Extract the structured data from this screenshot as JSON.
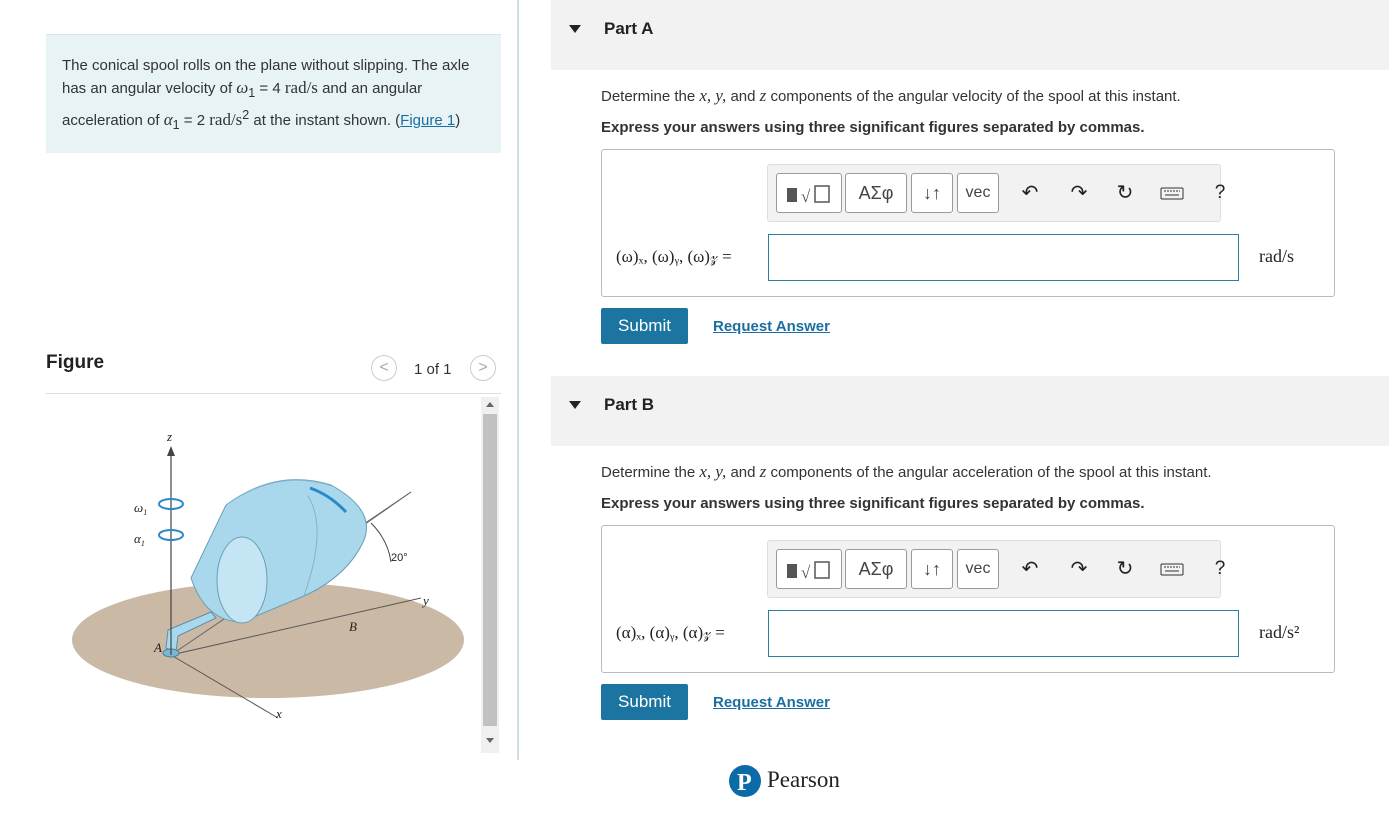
{
  "problem": {
    "text_1": "The conical spool rolls on the plane without slipping. The axle has an angular velocity of ",
    "omega_sym": "ω",
    "omega_sub": "1",
    "text_eq1": " = 4 ",
    "unit_1": "rad/s",
    "text_2": " and an angular acceleration of ",
    "alpha_sym": "α",
    "alpha_sub": "1",
    "text_eq2": " = 2 ",
    "unit_2": "rad/s",
    "unit_2_sup": "2",
    "text_3": " at the instant shown. (",
    "figure_link": "Figure 1",
    "text_4": ")"
  },
  "figure": {
    "title": "Figure",
    "pager_prev": "<",
    "pager_text": "1 of 1",
    "pager_next": ">",
    "labels": {
      "z": "z",
      "omega": "ω",
      "alpha": "α",
      "sub": "1",
      "angle": "20°",
      "y": "y",
      "A": "A",
      "B": "B",
      "x": "x"
    },
    "colors": {
      "plane": "#c9b9a5",
      "cone": "#a9d8ec",
      "axis": "#444444"
    }
  },
  "parts": [
    {
      "title": "Part A",
      "question_pre": "Determine the ",
      "question_vars": "x, y,",
      "question_mid": " and ",
      "question_z": "z",
      "question_post": " components of the angular velocity of the spool at this instant.",
      "instruction": "Express your answers using three significant figures separated by commas.",
      "answer_label": "(ω)ₓ, (ω)ᵧ, (ω)𝓏 =",
      "answer_value": "",
      "unit": "rad/s",
      "submit": "Submit",
      "request": "Request Answer"
    },
    {
      "title": "Part B",
      "question_pre": "Determine the ",
      "question_vars": "x, y,",
      "question_mid": " and ",
      "question_z": "z",
      "question_post": " components of the angular acceleration of the spool at this instant.",
      "instruction": "Express your answers using three significant figures separated by commas.",
      "answer_label": "(α)ₓ, (α)ᵧ, (α)𝓏 =",
      "answer_value": "",
      "unit": "rad/s²",
      "submit": "Submit",
      "request": "Request Answer"
    }
  ],
  "toolbar": {
    "greek": "ΑΣφ",
    "arrows": "↓↑",
    "vec": "vec",
    "help": "?",
    "icons": [
      "templates-icon",
      "greek-icon",
      "subscript-icon",
      "vector-icon",
      "undo-icon",
      "redo-icon",
      "reset-icon",
      "keyboard-icon",
      "help-icon"
    ]
  },
  "footer": {
    "brand": "Pearson",
    "logo_letter": "P",
    "brand_color": "#0d6aa8"
  }
}
